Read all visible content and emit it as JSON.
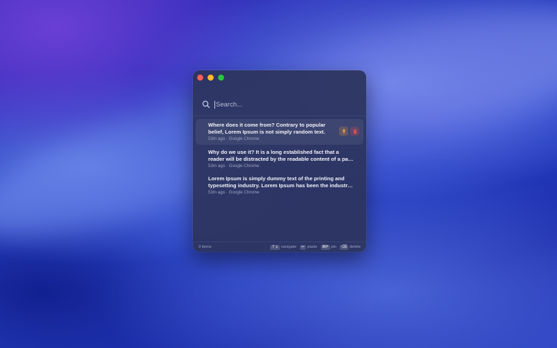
{
  "window": {
    "controls": {
      "close": "close",
      "minimize": "minimize",
      "zoom": "zoom"
    }
  },
  "search": {
    "placeholder": "Search...",
    "value": ""
  },
  "items": [
    {
      "text": "Where does it come from? Contrary to popular belief, Lorem Ipsum is not simply random text.",
      "time": "53m ago",
      "source": "Google Chrome",
      "selected": true
    },
    {
      "text": "Why do we use it? It is a long established fact that a reader will be distracted by the readable content of a page when looking at its layout.",
      "time": "53m ago",
      "source": "Google Chrome",
      "selected": false
    },
    {
      "text": "Lorem Ipsum is simply dummy text of the printing and typesetting industry. Lorem Ipsum has been the industry's standard dummy text.",
      "time": "53m ago",
      "source": "Google Chrome",
      "selected": false
    }
  ],
  "meta_separator": "·",
  "footer": {
    "count": "3 items",
    "hints": [
      {
        "key": "↑↓",
        "label": "navigate"
      },
      {
        "key": "↩",
        "label": "paste"
      },
      {
        "key": "⌘P",
        "label": "pin"
      },
      {
        "key": "⌫",
        "label": "delete"
      }
    ]
  },
  "colors": {
    "accent": "#f0a046",
    "delete": "#e05050",
    "window_bg": "#2c345c"
  },
  "icons": {
    "search": "search-icon",
    "pin": "pin-icon",
    "delete": "trash-icon"
  }
}
